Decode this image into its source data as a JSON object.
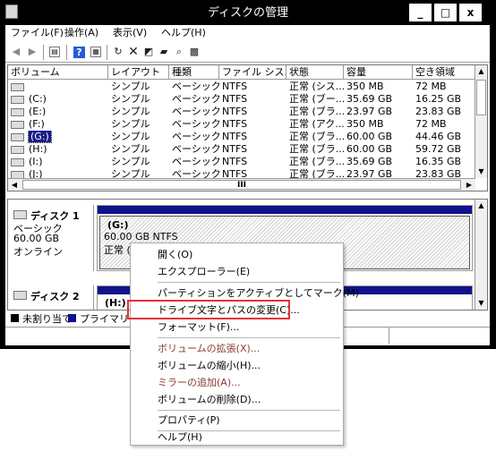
{
  "window": {
    "title": "ディスクの管理"
  },
  "menu": [
    "ファイル(F)",
    "操作(A)",
    "表示(V)",
    "ヘルプ(H)"
  ],
  "columns": [
    "ボリューム",
    "レイアウト",
    "種類",
    "ファイル シス...",
    "状態",
    "容量",
    "空き領域"
  ],
  "rows": [
    {
      "volume": "",
      "layout": "シンプル",
      "type": "ベーシック",
      "fs": "NTFS",
      "status": "正常 (シス...",
      "capacity": "350 MB",
      "free": "72 MB"
    },
    {
      "volume": "(C:)",
      "layout": "シンプル",
      "type": "ベーシック",
      "fs": "NTFS",
      "status": "正常 (ブー...",
      "capacity": "35.69 GB",
      "free": "16.25 GB"
    },
    {
      "volume": "(E:)",
      "layout": "シンプル",
      "type": "ベーシック",
      "fs": "NTFS",
      "status": "正常 (ブラ...",
      "capacity": "23.97 GB",
      "free": "23.83 GB"
    },
    {
      "volume": "(F:)",
      "layout": "シンプル",
      "type": "ベーシック",
      "fs": "NTFS",
      "status": "正常 (アク...",
      "capacity": "350 MB",
      "free": "72 MB"
    },
    {
      "volume": "(G:)",
      "layout": "シンプル",
      "type": "ベーシック",
      "fs": "NTFS",
      "status": "正常 (ブラ...",
      "capacity": "60.00 GB",
      "free": "44.46 GB",
      "selected": true
    },
    {
      "volume": "(H:)",
      "layout": "シンプル",
      "type": "ベーシック",
      "fs": "NTFS",
      "status": "正常 (ブラ...",
      "capacity": "60.00 GB",
      "free": "59.72 GB"
    },
    {
      "volume": "(I:)",
      "layout": "シンプル",
      "type": "ベーシック",
      "fs": "NTFS",
      "status": "正常 (ブラ...",
      "capacity": "35.69 GB",
      "free": "16.35 GB"
    },
    {
      "volume": "(J:)",
      "layout": "シンプル",
      "type": "ベーシック",
      "fs": "NTFS",
      "status": "正常 (ブラ...",
      "capacity": "23.97 GB",
      "free": "23.83 GB"
    }
  ],
  "hscroll_thumb": "III",
  "disk1": {
    "name": "ディスク 1",
    "type": "ベーシック",
    "size": "60.00 GB",
    "status": "オンライン",
    "partition": {
      "letter": "(G:)",
      "size_fs": "60.00 GB NTFS",
      "status": "正常 (プ"
    }
  },
  "disk2": {
    "name": "ディスク 2",
    "partition_letter": "(H:)"
  },
  "legend": {
    "unallocated": "未割り当て",
    "primary": "プライマリ パー"
  },
  "context_menu": {
    "open": "開く(O)",
    "explorer": "エクスプローラー(E)",
    "mark_active": "パーティションをアクティブとしてマーク(M)",
    "change_letter": "ドライブ文字とパスの変更(C)...",
    "format": "フォーマット(F)...",
    "extend": "ボリュームの拡張(X)...",
    "shrink": "ボリュームの縮小(H)...",
    "add_mirror": "ミラーの追加(A)...",
    "delete": "ボリュームの削除(D)...",
    "properties": "プロパティ(P)",
    "help": "ヘルプ(H)"
  },
  "colors": {
    "titlebar": "#000000",
    "partition_header": "#11118a",
    "highlight_box": "#e0333a",
    "disabled_text": "#8b3a2e",
    "selection": "#1a1a8c"
  }
}
